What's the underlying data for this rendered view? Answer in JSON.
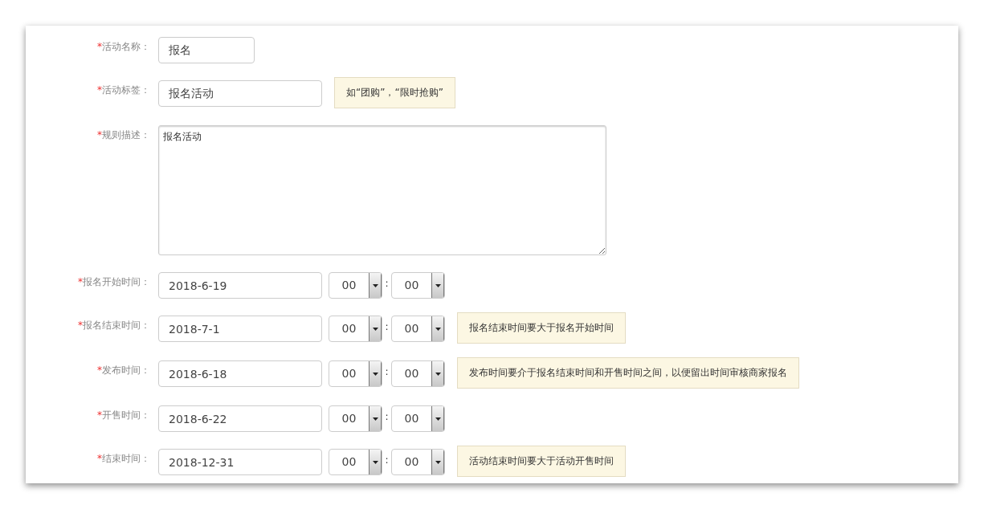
{
  "fields": [
    {
      "kind": "shorttext",
      "mark": "*",
      "label": "活动名称：",
      "value": "报名"
    },
    {
      "kind": "text",
      "mark": "*",
      "label": "活动标签：",
      "value": "报名活动",
      "tip": "如“团购”，“限时抢购”"
    },
    {
      "kind": "textarea",
      "mark": "*",
      "label": "规则描述：",
      "value": "报名活动"
    },
    {
      "kind": "datetime",
      "mark": "*",
      "label": "报名开始时间：",
      "value": "2018-6-19",
      "hour": "00",
      "sep": ":",
      "minute": "00"
    },
    {
      "kind": "datetime",
      "mark": "*",
      "label": "报名结束时间：",
      "value": "2018-7-1",
      "hour": "00",
      "sep": ":",
      "minute": "00",
      "tip": "报名结束时间要大于报名开始时间"
    },
    {
      "kind": "datetime",
      "mark": "*",
      "label": "发布时间：",
      "value": "2018-6-18",
      "hour": "00",
      "sep": ":",
      "minute": "00",
      "tip": "发布时间要介于报名结束时间和开售时间之间，以便留出时间审核商家报名"
    },
    {
      "kind": "datetime",
      "mark": "*",
      "label": "开售时间：",
      "value": "2018-6-22",
      "hour": "00",
      "sep": ":",
      "minute": "00"
    },
    {
      "kind": "datetime",
      "mark": "*",
      "label": "结束时间：",
      "value": "2018-12-31",
      "hour": "00",
      "sep": ":",
      "minute": "00",
      "tip": "活动结束时间要大于活动开售时间"
    }
  ]
}
